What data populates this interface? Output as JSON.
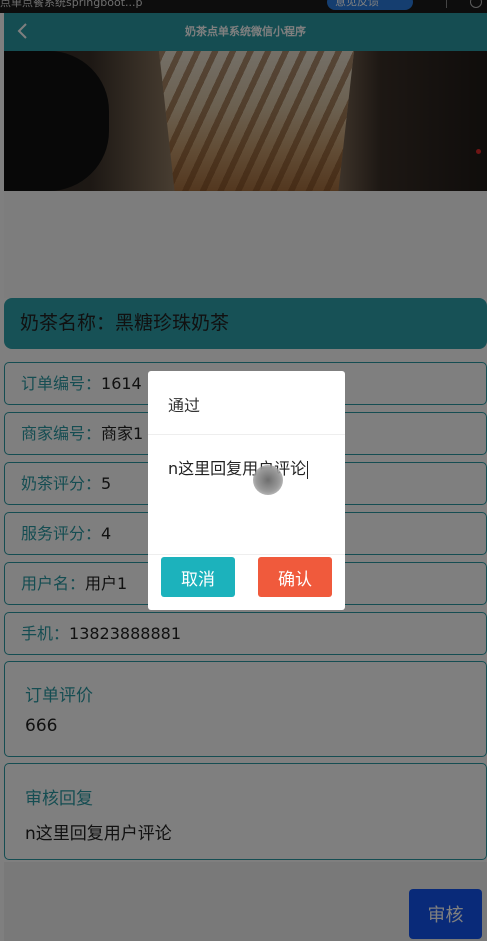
{
  "browser": {
    "url_fragment": "点单点餐系统springboot...p",
    "feedback_label": "意见反馈"
  },
  "navbar": {
    "title": "奶茶点单系统微信小程序"
  },
  "product": {
    "name_label": "奶茶名称：",
    "name_value": "黑糖珍珠奶茶"
  },
  "fields": [
    {
      "label": "订单编号：",
      "value": "1614"
    },
    {
      "label": "商家编号：",
      "value": "商家1"
    },
    {
      "label": "奶茶评分：",
      "value": "5"
    },
    {
      "label": "服务评分：",
      "value": "4"
    },
    {
      "label": "用户名：",
      "value": "用户1"
    },
    {
      "label": "手机：",
      "value": "13823888881"
    }
  ],
  "review": {
    "label": "订单评价",
    "value": "666"
  },
  "reply": {
    "label": "审核回复",
    "value": "n这里回复用户评论"
  },
  "audit_button": "审核",
  "dialog": {
    "title": "通过",
    "input_value": "n这里回复用户评论",
    "cancel_label": "取消",
    "confirm_label": "确认"
  },
  "colors": {
    "navbar": "#2b9aa4",
    "cancel": "#1cb2bc",
    "confirm": "#f05a3c",
    "audit": "#1255f2"
  }
}
